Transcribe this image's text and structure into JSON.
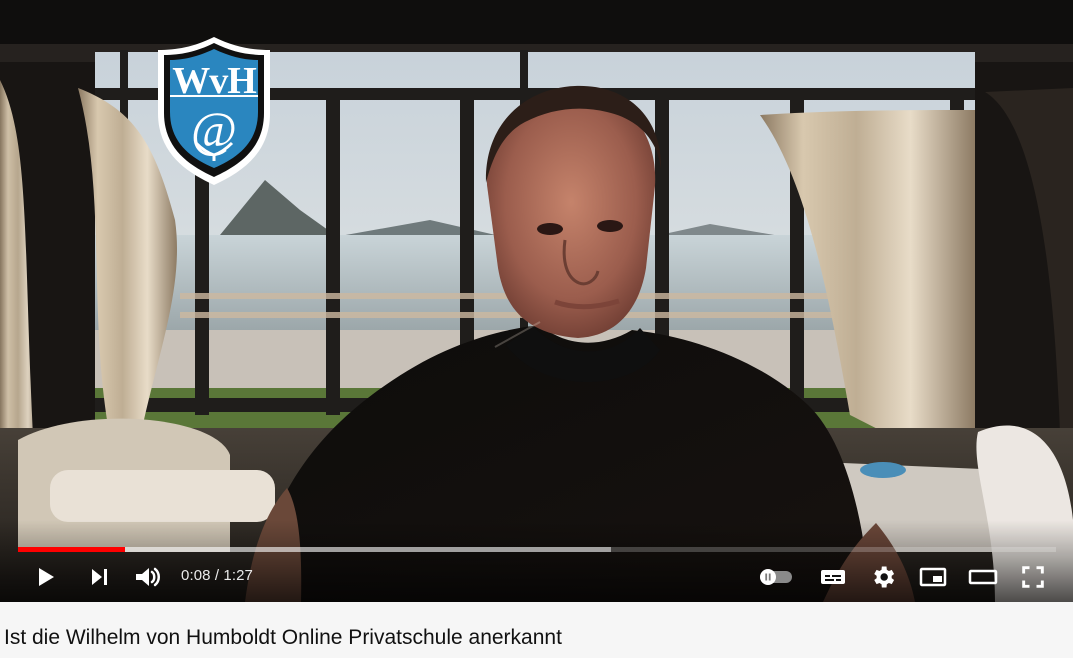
{
  "player": {
    "time_display": "0:08 / 1:27",
    "played_fraction": 0.103,
    "buffered_fraction": 0.571,
    "progress_color": "#ff0000",
    "icons": [
      "play-icon",
      "next-icon",
      "volume-icon",
      "autoplay-toggle-icon",
      "subtitles-icon",
      "settings-icon",
      "miniplayer-icon",
      "theater-mode-icon",
      "fullscreen-icon"
    ]
  },
  "branding": {
    "logo_text": "WvH",
    "logo_symbol": "@",
    "logo_color": "#2a86bf"
  },
  "video": {
    "title": "Ist die Wilhelm von Humboldt Online Privatschule anerkannt"
  }
}
